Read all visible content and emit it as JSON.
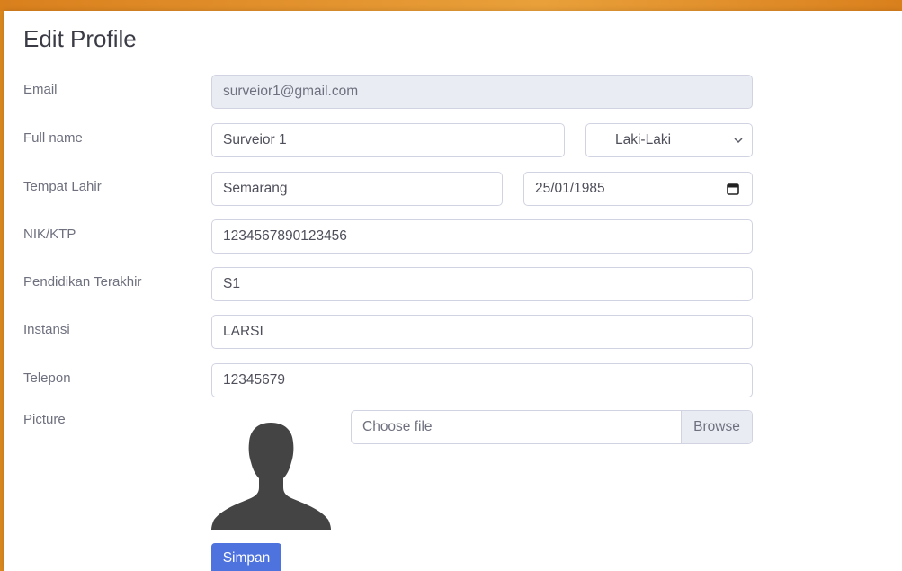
{
  "page": {
    "title": "Edit Profile"
  },
  "colors": {
    "accent": "#4e73df",
    "frame": "#dd8a1f",
    "readonly_bg": "#eaecf4"
  },
  "form": {
    "email": {
      "label": "Email",
      "value": "surveior1@gmail.com"
    },
    "full_name": {
      "label": "Full name",
      "value": "Surveior 1"
    },
    "gender": {
      "value": "Laki-Laki",
      "icon": "chevron-down-icon"
    },
    "tempat_lahir": {
      "label": "Tempat Lahir",
      "value": "Semarang"
    },
    "tanggal_lahir": {
      "value": "25/01/1985",
      "icon": "calendar-icon"
    },
    "nik": {
      "label": "NIK/KTP",
      "value": "1234567890123456"
    },
    "pendidikan": {
      "label": "Pendidikan Terakhir",
      "value": "S1"
    },
    "instansi": {
      "label": "Instansi",
      "value": "LARSI"
    },
    "telepon": {
      "label": "Telepon",
      "value": "12345679"
    },
    "picture": {
      "label": "Picture",
      "file_placeholder": "Choose file",
      "browse_label": "Browse",
      "avatar_icon": "avatar-placeholder-icon"
    },
    "submit_label": "Simpan"
  }
}
